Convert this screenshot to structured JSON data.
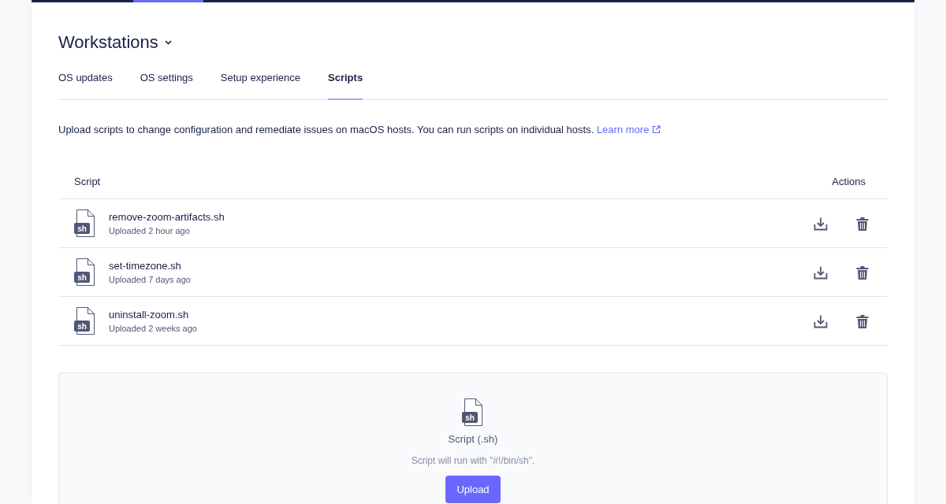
{
  "header": {
    "title": "Workstations"
  },
  "tabs": [
    {
      "label": "OS updates",
      "selected": false
    },
    {
      "label": "OS settings",
      "selected": false
    },
    {
      "label": "Setup experience",
      "selected": false
    },
    {
      "label": "Scripts",
      "selected": true
    }
  ],
  "description": {
    "text": "Upload scripts to change configuration and remediate issues on macOS hosts. You can run scripts on individual hosts.",
    "link": "Learn more"
  },
  "table": {
    "columns": [
      "Script",
      "Actions"
    ],
    "rows": [
      {
        "file_type": "sh",
        "name": "remove-zoom-artifacts.sh",
        "uploaded": "Uploaded 2 hour ago"
      },
      {
        "file_type": "sh",
        "name": "set-timezone.sh",
        "uploaded": "Uploaded 7 days ago"
      },
      {
        "file_type": "sh",
        "name": "uninstall-zoom.sh",
        "uploaded": "Uploaded 2 weeks ago"
      }
    ]
  },
  "upload": {
    "file_type": "sh",
    "title": "Script (.sh)",
    "hint": "Script will run with \"#!/bin/sh\".",
    "button": "Upload"
  }
}
